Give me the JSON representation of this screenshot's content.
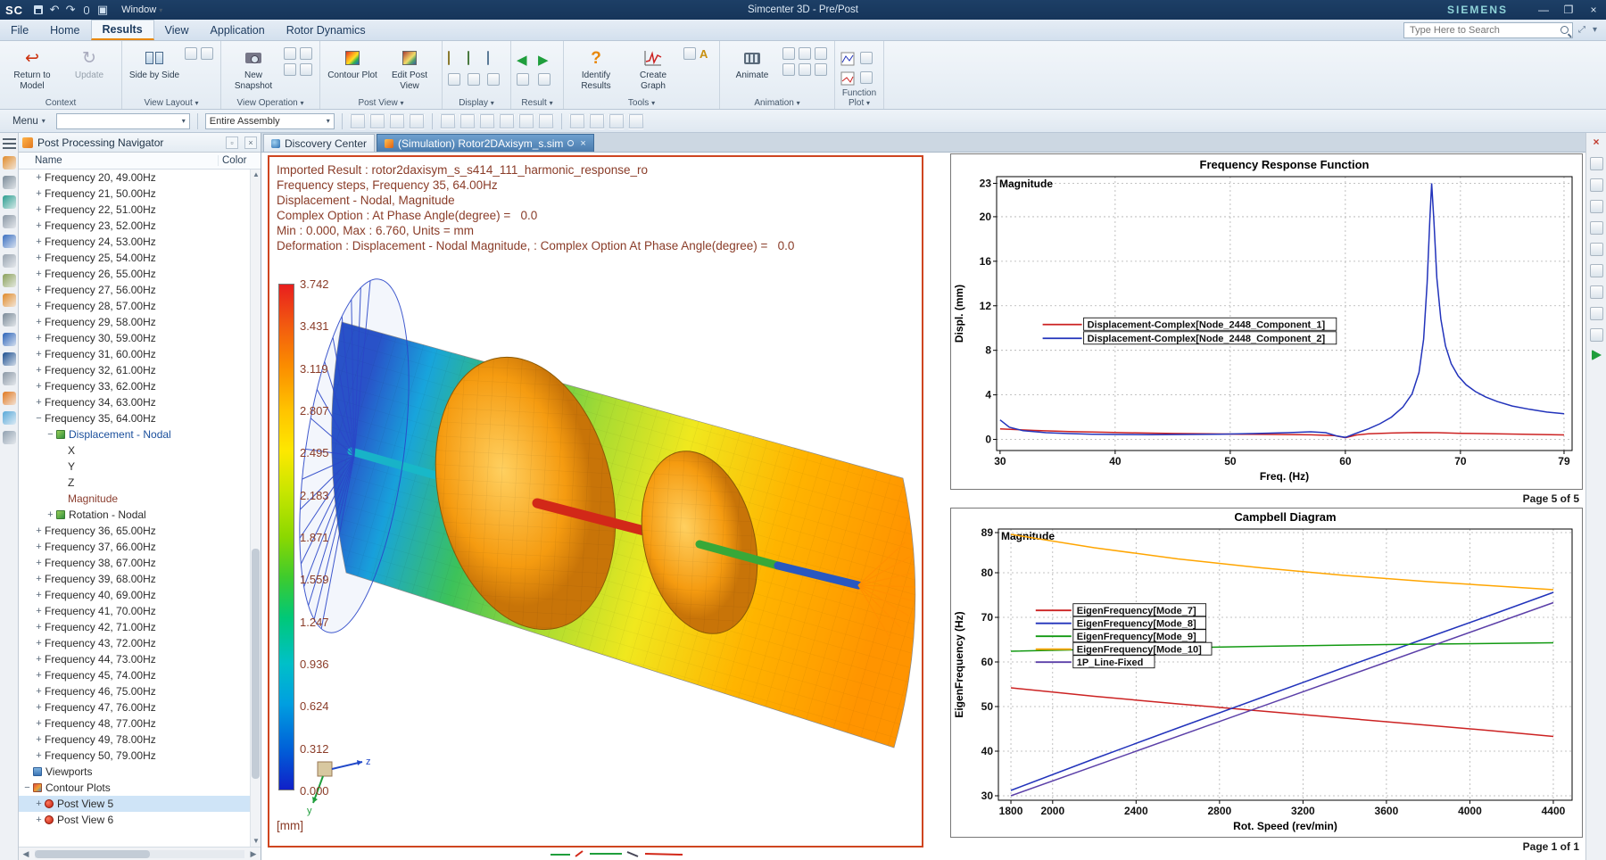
{
  "titlebar": {
    "logo": "SC",
    "window_menu": "Window",
    "app_title": "Simcenter 3D - Pre/Post",
    "brand": "SIEMENS",
    "minimize": "—",
    "maximize": "❐",
    "close": "×"
  },
  "menubar": {
    "items": [
      "File",
      "Home",
      "Results",
      "View",
      "Application",
      "Rotor Dynamics"
    ],
    "active_item": "Results",
    "search_placeholder": "Type Here to Search"
  },
  "ribbon": {
    "context": {
      "label": "Context",
      "return_to_model": "Return to Model",
      "update": "Update"
    },
    "view_layout": {
      "label": "View Layout",
      "side_by_side": "Side by Side"
    },
    "view_operation": {
      "label": "View Operation",
      "new_snapshot": "New Snapshot"
    },
    "post_view": {
      "label": "Post View",
      "contour_plot": "Contour Plot",
      "edit_post_view": "Edit Post View"
    },
    "display": {
      "label": "Display"
    },
    "result": {
      "label": "Result"
    },
    "tools": {
      "label": "Tools",
      "identify_results": "Identify Results",
      "create_graph": "Create Graph"
    },
    "animation": {
      "label": "Animation",
      "animate": "Animate"
    },
    "function_plot": {
      "label": "Function Plot"
    }
  },
  "toolbar2": {
    "menu_label": "Menu",
    "selection_value": "",
    "scope_value": "Entire Assembly"
  },
  "navigator": {
    "title": "Post Processing Navigator",
    "columns": {
      "name": "Name",
      "color": "Color"
    },
    "tree": [
      {
        "label": "Frequency 20, 49.00Hz",
        "level": 1,
        "exp": "plus"
      },
      {
        "label": "Frequency 21, 50.00Hz",
        "level": 1,
        "exp": "plus"
      },
      {
        "label": "Frequency 22, 51.00Hz",
        "level": 1,
        "exp": "plus"
      },
      {
        "label": "Frequency 23, 52.00Hz",
        "level": 1,
        "exp": "plus"
      },
      {
        "label": "Frequency 24, 53.00Hz",
        "level": 1,
        "exp": "plus"
      },
      {
        "label": "Frequency 25, 54.00Hz",
        "level": 1,
        "exp": "plus"
      },
      {
        "label": "Frequency 26, 55.00Hz",
        "level": 1,
        "exp": "plus"
      },
      {
        "label": "Frequency 27, 56.00Hz",
        "level": 1,
        "exp": "plus"
      },
      {
        "label": "Frequency 28, 57.00Hz",
        "level": 1,
        "exp": "plus"
      },
      {
        "label": "Frequency 29, 58.00Hz",
        "level": 1,
        "exp": "plus"
      },
      {
        "label": "Frequency 30, 59.00Hz",
        "level": 1,
        "exp": "plus"
      },
      {
        "label": "Frequency 31, 60.00Hz",
        "level": 1,
        "exp": "plus"
      },
      {
        "label": "Frequency 32, 61.00Hz",
        "level": 1,
        "exp": "plus"
      },
      {
        "label": "Frequency 33, 62.00Hz",
        "level": 1,
        "exp": "plus"
      },
      {
        "label": "Frequency 34, 63.00Hz",
        "level": 1,
        "exp": "plus"
      },
      {
        "label": "Frequency 35, 64.00Hz",
        "level": 1,
        "exp": "minus"
      },
      {
        "label": "Displacement - Nodal",
        "level": 2,
        "exp": "minus",
        "icon": "result",
        "color": "#1a4f9c"
      },
      {
        "label": "X",
        "level": 3
      },
      {
        "label": "Y",
        "level": 3
      },
      {
        "label": "Z",
        "level": 3
      },
      {
        "label": "Magnitude",
        "level": 3,
        "color": "#8b3e2f"
      },
      {
        "label": "Rotation - Nodal",
        "level": 2,
        "exp": "plus",
        "icon": "result"
      },
      {
        "label": "Frequency 36, 65.00Hz",
        "level": 1,
        "exp": "plus"
      },
      {
        "label": "Frequency 37, 66.00Hz",
        "level": 1,
        "exp": "plus"
      },
      {
        "label": "Frequency 38, 67.00Hz",
        "level": 1,
        "exp": "plus"
      },
      {
        "label": "Frequency 39, 68.00Hz",
        "level": 1,
        "exp": "plus"
      },
      {
        "label": "Frequency 40, 69.00Hz",
        "level": 1,
        "exp": "plus"
      },
      {
        "label": "Frequency 41, 70.00Hz",
        "level": 1,
        "exp": "plus"
      },
      {
        "label": "Frequency 42, 71.00Hz",
        "level": 1,
        "exp": "plus"
      },
      {
        "label": "Frequency 43, 72.00Hz",
        "level": 1,
        "exp": "plus"
      },
      {
        "label": "Frequency 44, 73.00Hz",
        "level": 1,
        "exp": "plus"
      },
      {
        "label": "Frequency 45, 74.00Hz",
        "level": 1,
        "exp": "plus"
      },
      {
        "label": "Frequency 46, 75.00Hz",
        "level": 1,
        "exp": "plus"
      },
      {
        "label": "Frequency 47, 76.00Hz",
        "level": 1,
        "exp": "plus"
      },
      {
        "label": "Frequency 48, 77.00Hz",
        "level": 1,
        "exp": "plus"
      },
      {
        "label": "Frequency 49, 78.00Hz",
        "level": 1,
        "exp": "plus"
      },
      {
        "label": "Frequency 50, 79.00Hz",
        "level": 1,
        "exp": "plus"
      },
      {
        "label": "Viewports",
        "level": 0,
        "icon": "viewports"
      },
      {
        "label": "Contour Plots",
        "level": 0,
        "exp": "minus",
        "icon": "contour"
      },
      {
        "label": "Post View 5",
        "level": 1,
        "exp": "plus",
        "icon": "postview",
        "selected": true
      },
      {
        "label": "Post View 6",
        "level": 1,
        "exp": "plus",
        "icon": "postview"
      }
    ]
  },
  "tabs": {
    "discovery": "Discovery Center",
    "simulation": "(Simulation) Rotor2DAxisym_s.sim"
  },
  "viewport": {
    "annotations": [
      "Imported Result : rotor2daxisym_s_s414_111_harmonic_response_ro",
      "Frequency steps, Frequency 35, 64.00Hz",
      "Displacement - Nodal, Magnitude",
      "Complex Option : At Phase Angle(degree) =   0.0",
      "Min : 0.000, Max : 6.760, Units = mm",
      "Deformation : Displacement - Nodal Magnitude, : Complex Option At Phase Angle(degree) =   0.0"
    ],
    "colorbar": {
      "values": [
        "3.742",
        "3.431",
        "3.119",
        "2.807",
        "2.495",
        "2.183",
        "1.871",
        "1.559",
        "1.247",
        "0.936",
        "0.624",
        "0.312",
        "0.000"
      ],
      "unit": "[mm]"
    },
    "triad": {
      "y_label": "y",
      "z_label": "z"
    }
  },
  "chart_data": [
    {
      "type": "line",
      "title": "Frequency Response Function",
      "corner_label": "Magnitude",
      "xlabel": "Freq. (Hz)",
      "ylabel": "Displ. (mm)",
      "xlim": [
        29.7,
        79.7
      ],
      "ylim": [
        -1,
        23.6
      ],
      "xticks": [
        30,
        40,
        50,
        60,
        70,
        79
      ],
      "yticks": [
        0,
        4,
        8,
        12,
        16,
        20,
        23
      ],
      "grid": true,
      "legend_position": "center-left",
      "page_label": "Page 5 of 5",
      "series": [
        {
          "name": "Displacement-Complex[Node_2448_Component_1]",
          "color": "#cc2222",
          "points": [
            [
              30,
              0.95
            ],
            [
              33,
              0.8
            ],
            [
              36,
              0.71
            ],
            [
              39,
              0.64
            ],
            [
              42,
              0.58
            ],
            [
              45,
              0.53
            ],
            [
              48,
              0.5
            ],
            [
              51,
              0.47
            ],
            [
              54,
              0.44
            ],
            [
              57,
              0.41
            ],
            [
              59,
              0.35
            ],
            [
              60,
              0.15
            ],
            [
              61,
              0.4
            ],
            [
              62,
              0.5
            ],
            [
              64,
              0.57
            ],
            [
              66,
              0.61
            ],
            [
              68,
              0.6
            ],
            [
              70,
              0.55
            ],
            [
              73,
              0.5
            ],
            [
              76,
              0.45
            ],
            [
              79,
              0.4
            ]
          ]
        },
        {
          "name": "Displacement-Complex[Node_2448_Component_2]",
          "color": "#2233bb",
          "points": [
            [
              30,
              1.75
            ],
            [
              30.8,
              1.1
            ],
            [
              32,
              0.78
            ],
            [
              34,
              0.6
            ],
            [
              36,
              0.52
            ],
            [
              38,
              0.47
            ],
            [
              40,
              0.44
            ],
            [
              43,
              0.43
            ],
            [
              46,
              0.44
            ],
            [
              49,
              0.47
            ],
            [
              52,
              0.52
            ],
            [
              55,
              0.6
            ],
            [
              57,
              0.68
            ],
            [
              58.3,
              0.6
            ],
            [
              59.3,
              0.3
            ],
            [
              60,
              0.18
            ],
            [
              60.8,
              0.5
            ],
            [
              62,
              0.95
            ],
            [
              63,
              1.4
            ],
            [
              64,
              2.0
            ],
            [
              65,
              2.9
            ],
            [
              65.8,
              4.1
            ],
            [
              66.4,
              6.0
            ],
            [
              66.8,
              9.0
            ],
            [
              67.1,
              14.0
            ],
            [
              67.35,
              20.0
            ],
            [
              67.5,
              23.0
            ],
            [
              67.7,
              19.5
            ],
            [
              67.95,
              14.5
            ],
            [
              68.3,
              10.8
            ],
            [
              68.7,
              8.4
            ],
            [
              69.2,
              6.8
            ],
            [
              69.8,
              5.7
            ],
            [
              70.5,
              4.9
            ],
            [
              71.3,
              4.3
            ],
            [
              72.2,
              3.8
            ],
            [
              73.2,
              3.4
            ],
            [
              74.5,
              3.0
            ],
            [
              76,
              2.7
            ],
            [
              77.5,
              2.45
            ],
            [
              79,
              2.3
            ]
          ]
        }
      ]
    },
    {
      "type": "line",
      "title": "Campbell Diagram",
      "corner_label": "Magnitude",
      "xlabel": "Rot. Speed (rev/min)",
      "ylabel": "EigenFrequency (Hz)",
      "xlim": [
        1740,
        4490
      ],
      "ylim": [
        29,
        89.8
      ],
      "xticks": [
        1800,
        2000,
        2400,
        2800,
        3200,
        3600,
        4000,
        4400
      ],
      "yticks": [
        30,
        40,
        50,
        60,
        70,
        80,
        89
      ],
      "grid": true,
      "legend_position": "upper-left",
      "page_label": "Page 1 of 1",
      "series": [
        {
          "name": "EigenFrequency[Mode_7]",
          "color": "#cc2222",
          "points": [
            [
              1800,
              54.2
            ],
            [
              2200,
              52.3
            ],
            [
              2600,
              50.6
            ],
            [
              3000,
              49.0
            ],
            [
              3400,
              47.4
            ],
            [
              3800,
              45.8
            ],
            [
              4100,
              44.6
            ],
            [
              4400,
              43.3
            ]
          ]
        },
        {
          "name": "EigenFrequency[Mode_8]",
          "color": "#2233bb",
          "points": [
            [
              1800,
              31.2
            ],
            [
              2200,
              38.3
            ],
            [
              2600,
              45.2
            ],
            [
              3000,
              52.0
            ],
            [
              3400,
              58.8
            ],
            [
              3800,
              65.5
            ],
            [
              4100,
              70.5
            ],
            [
              4400,
              75.6
            ]
          ]
        },
        {
          "name": "EigenFrequency[Mode_9]",
          "color": "#119911",
          "points": [
            [
              1800,
              62.4
            ],
            [
              2400,
              63.0
            ],
            [
              3000,
              63.5
            ],
            [
              3600,
              63.9
            ],
            [
              4400,
              64.3
            ]
          ]
        },
        {
          "name": "EigenFrequency[Mode_10]",
          "color": "#ffa500",
          "points": [
            [
              1800,
              88.6
            ],
            [
              2200,
              85.6
            ],
            [
              2600,
              83.1
            ],
            [
              3000,
              81.1
            ],
            [
              3400,
              79.4
            ],
            [
              3800,
              78.0
            ],
            [
              4100,
              77.1
            ],
            [
              4400,
              76.2
            ]
          ]
        },
        {
          "name": "1P_Line-Fixed",
          "color": "#5b3fa8",
          "points": [
            [
              1800,
              30.0
            ],
            [
              4400,
              73.3
            ]
          ]
        }
      ]
    }
  ],
  "left_strip": [
    "menu",
    "part-navigator",
    "simulation-navigator",
    "post-processing-navigator",
    "xy-function-navigator",
    "clipboard",
    "view-manager",
    "layers",
    "assembly-constraints",
    "materials",
    "groups",
    "selection",
    "measure",
    "history",
    "user-defaults",
    "touch-mode"
  ],
  "right_strip": [
    "close-pane",
    "view-cube",
    "window-split",
    "display-grid",
    "plot-layout",
    "page-layout",
    "zoom-view",
    "pan-view",
    "fit-view",
    "refresh-display",
    "forward-navigation"
  ]
}
